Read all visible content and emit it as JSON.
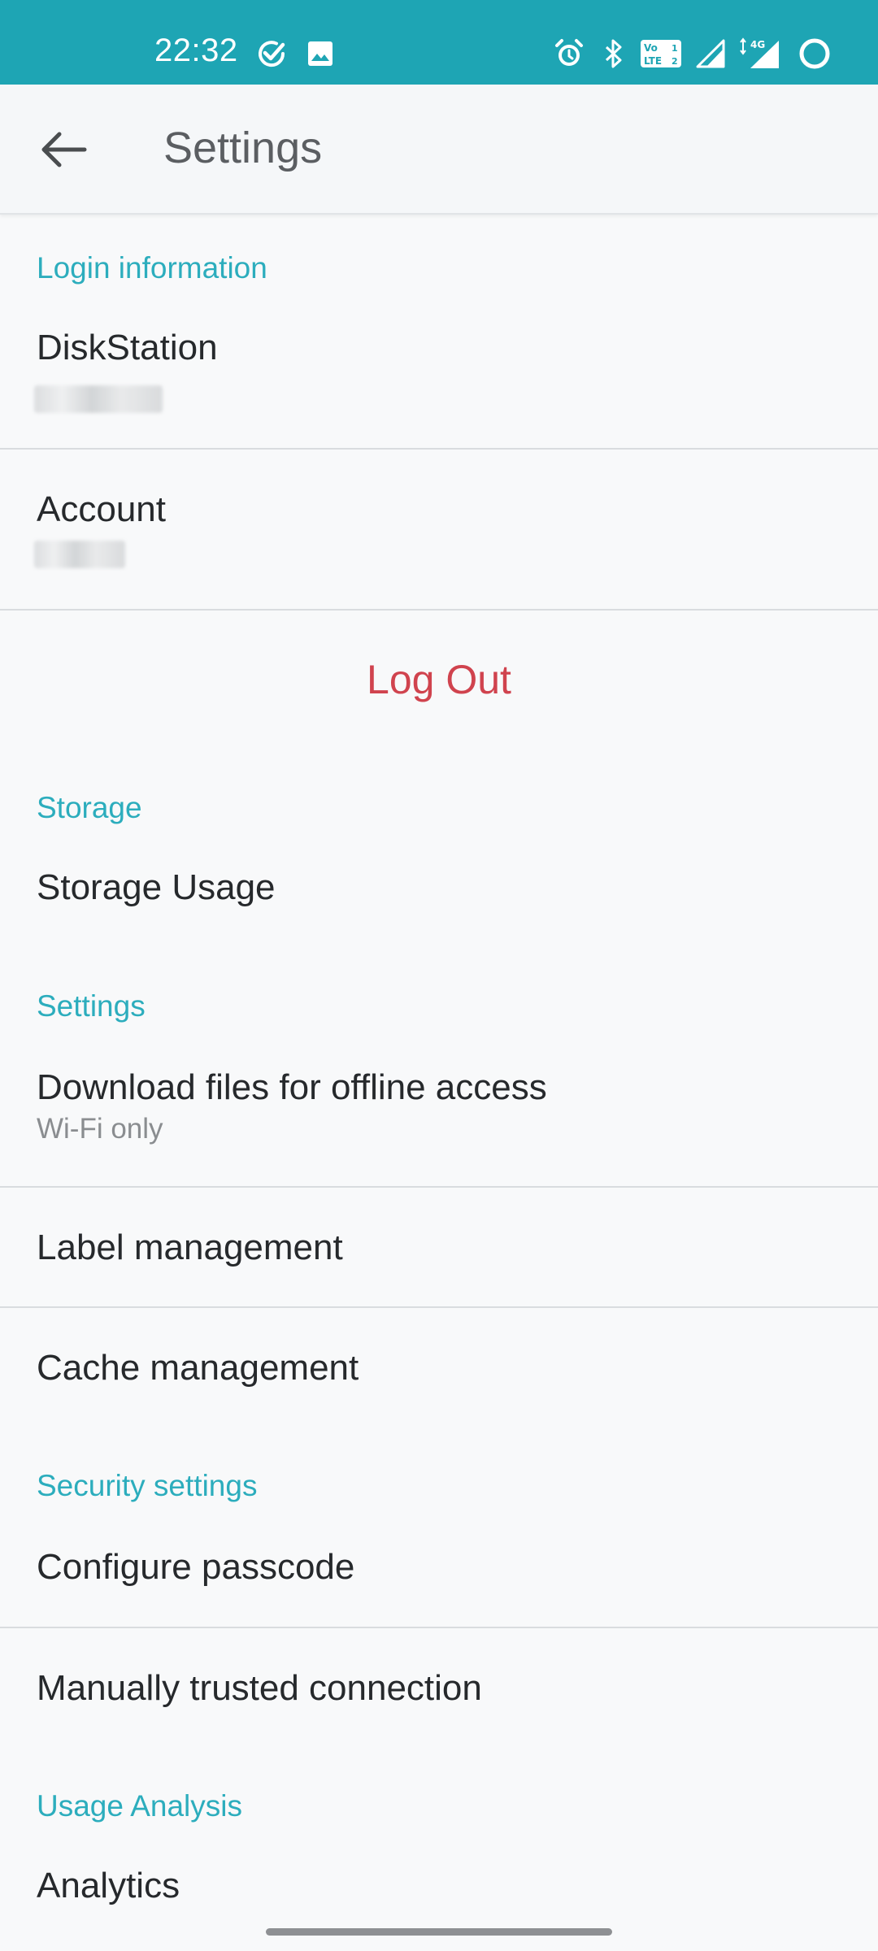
{
  "status_bar": {
    "time": "22:32",
    "icons": [
      "check-circle-icon",
      "image-icon",
      "alarm-icon",
      "bluetooth-icon",
      "volte-icon",
      "signal-icon",
      "4g-signal-icon",
      "battery-ring-icon"
    ],
    "background": "#1ea5b4"
  },
  "app_bar": {
    "title": "Settings"
  },
  "sections": {
    "login": {
      "header": "Login information",
      "diskstation_title": "DiskStation",
      "account_title": "Account",
      "logout_label": "Log Out"
    },
    "storage": {
      "header": "Storage",
      "usage_title": "Storage Usage"
    },
    "settings": {
      "header": "Settings",
      "offline_title": "Download files for offline access",
      "offline_value": "Wi-Fi only",
      "label_title": "Label management",
      "cache_title": "Cache management"
    },
    "security": {
      "header": "Security settings",
      "passcode_title": "Configure passcode",
      "trusted_title": "Manually trusted connection"
    },
    "analysis": {
      "header": "Usage Analysis",
      "analytics_title": "Analytics"
    }
  },
  "colors": {
    "accent": "#2cadbd",
    "danger": "#d0434e",
    "text_primary": "#26292c",
    "text_secondary": "#8a8d90"
  }
}
